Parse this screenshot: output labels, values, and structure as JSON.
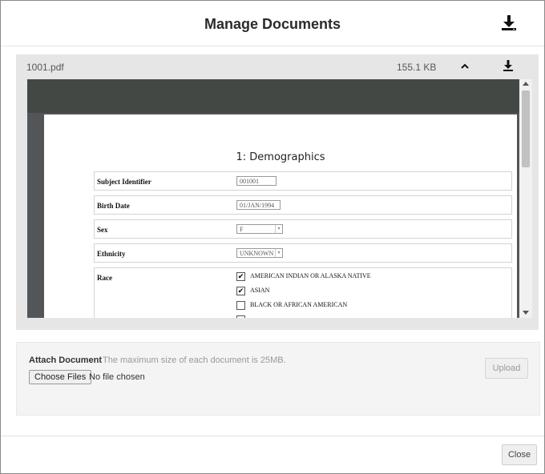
{
  "dialog": {
    "title": "Manage Documents",
    "header_icon": "download-icon"
  },
  "document": {
    "name": "1001.pdf",
    "size": "155.1 KB",
    "collapse_icon": "chevron-up-icon",
    "download_icon": "download-icon"
  },
  "pdf": {
    "form_title": "1: Demographics",
    "fields": [
      {
        "label": "Subject Identifier",
        "value": "001001"
      },
      {
        "label": "Birth Date",
        "value": "01/JAN/1994"
      },
      {
        "label": "Sex",
        "value": "F"
      },
      {
        "label": "Ethnicity",
        "value": "UNKNOWN"
      },
      {
        "label": "Race"
      }
    ],
    "race_options": [
      {
        "label": "AMERICAN INDIAN OR ALASKA NATIVE",
        "checked": true
      },
      {
        "label": "ASIAN",
        "checked": true
      },
      {
        "label": "BLACK OR AFRICAN AMERICAN",
        "checked": false
      }
    ]
  },
  "attach": {
    "label": "Attach Document",
    "hint": "The maximum size of each document is 25MB.",
    "choose_label": "Choose Files",
    "no_file_text": "No file chosen",
    "upload_label": "Upload"
  },
  "footer": {
    "close_label": "Close"
  }
}
